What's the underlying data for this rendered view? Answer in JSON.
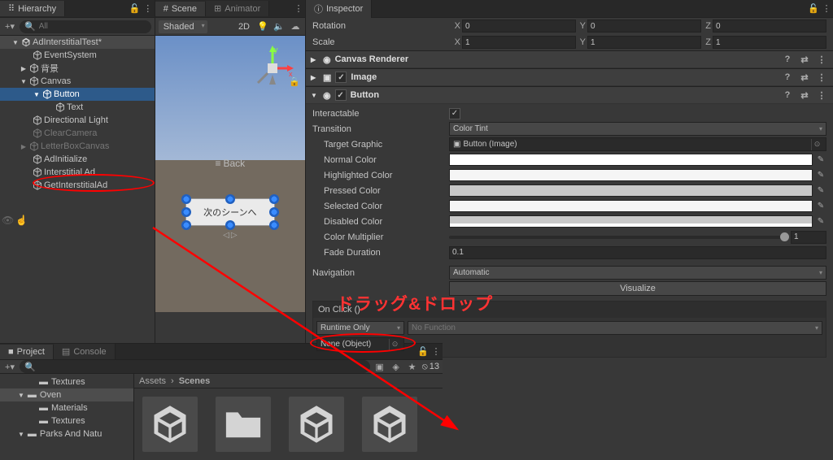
{
  "hierarchy": {
    "tab": "Hierarchy",
    "search_placeholder": "All",
    "items": [
      {
        "label": "AdInterstitialTest*",
        "type": "scene"
      },
      {
        "label": "EventSystem"
      },
      {
        "label": "背景"
      },
      {
        "label": "Canvas"
      },
      {
        "label": "Button",
        "selected": true
      },
      {
        "label": "Text"
      },
      {
        "label": "Directional Light"
      },
      {
        "label": "ClearCamera",
        "dim": true
      },
      {
        "label": "LetterBoxCanvas",
        "dim": true
      },
      {
        "label": "AdInitialize"
      },
      {
        "label": "Interstitial Ad"
      },
      {
        "label": "GetInterstitialAd"
      }
    ]
  },
  "scene": {
    "tab_scene": "Scene",
    "tab_animator": "Animator",
    "shading": "Shaded",
    "mode2d": "2D",
    "back_label": "Back",
    "button_text": "次のシーンへ",
    "axis_x": "x",
    "axis_y": "y"
  },
  "project": {
    "tab_project": "Project",
    "tab_console": "Console",
    "hidden_count": "13",
    "tree": [
      {
        "label": "Textures",
        "indent": 3
      },
      {
        "label": "Oven",
        "indent": 2,
        "expanded": true,
        "sel": true
      },
      {
        "label": "Materials",
        "indent": 3
      },
      {
        "label": "Textures",
        "indent": 3
      },
      {
        "label": "Parks And Natu",
        "indent": 2,
        "expanded": true
      }
    ],
    "breadcrumb": [
      "Assets",
      "Scenes"
    ]
  },
  "inspector": {
    "tab": "Inspector",
    "rotation_label": "Rotation",
    "scale_label": "Scale",
    "rotation": {
      "x": "0",
      "y": "0",
      "z": "0"
    },
    "scale": {
      "x": "1",
      "y": "1",
      "z": "1"
    },
    "components": [
      {
        "name": "Canvas Renderer",
        "expanded": false,
        "checkbox": false
      },
      {
        "name": "Image",
        "expanded": false,
        "checkbox": true,
        "checked": true
      },
      {
        "name": "Button",
        "expanded": true,
        "checkbox": true,
        "checked": true
      }
    ],
    "button": {
      "interactable_label": "Interactable",
      "interactable": true,
      "transition_label": "Transition",
      "transition": "Color Tint",
      "target_graphic_label": "Target Graphic",
      "target_graphic": "Button (Image)",
      "normal_color_label": "Normal Color",
      "highlighted_color_label": "Highlighted Color",
      "pressed_color_label": "Pressed Color",
      "selected_color_label": "Selected Color",
      "disabled_color_label": "Disabled Color",
      "multiplier_label": "Color Multiplier",
      "multiplier": "1",
      "fade_label": "Fade Duration",
      "fade": "0.1",
      "navigation_label": "Navigation",
      "navigation": "Automatic",
      "visualize": "Visualize",
      "onclick_header": "On Click ()",
      "runtime": "Runtime Only",
      "nofunction": "No Function",
      "object": "None (Object)"
    },
    "colors": {
      "normal": "#ffffff",
      "highlighted": "#f5f5f5",
      "pressed": "#c8c8c8",
      "selected": "#f5f5f5",
      "disabled": "linear-gradient(to right,#c8c8c8 80%,#fff 80%)"
    }
  },
  "annotation": {
    "text": "ドラッグ&ドロップ"
  }
}
